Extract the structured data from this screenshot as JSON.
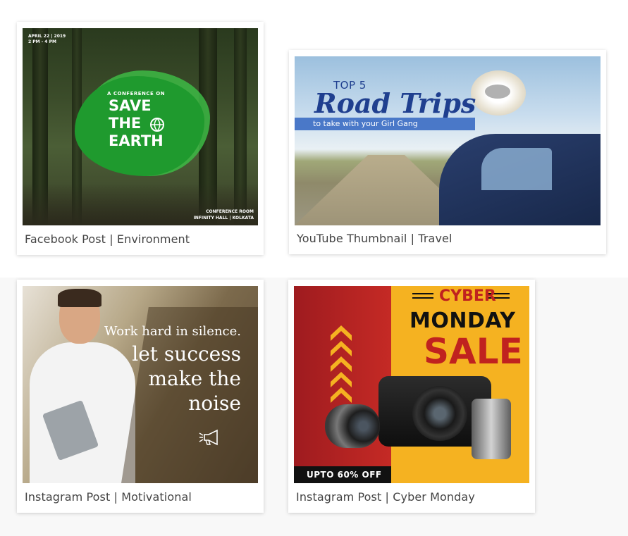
{
  "cards": [
    {
      "caption": "Facebook Post | Environment",
      "date_line": "APRIL 22 | 2019",
      "time_line": "2 PM - 4 PM",
      "kicker": "A CONFERENCE ON",
      "headline_1": "SAVE",
      "headline_2": "THE",
      "headline_3": "EARTH",
      "venue_1": "CONFERENCE ROOM",
      "venue_2": "INFINITY HALL | KOLKATA",
      "colors": {
        "blob": "#1f9a2e",
        "blob_light": "#3dbb45"
      }
    },
    {
      "caption": "YouTube Thumbnail | Travel",
      "small_title": "TOP 5",
      "big_title": "Road Trips",
      "banner": "to take with your Girl Gang",
      "colors": {
        "title": "#1f3f8f",
        "banner": "#4a78c8"
      }
    },
    {
      "caption": "Instagram Post | Motivational",
      "line_1": "Work hard in silence.",
      "line_2": "let success",
      "line_3": "make the",
      "line_4": "noise"
    },
    {
      "caption": "Instagram Post | Cyber Monday",
      "word_1": "CYBER",
      "word_2": "MONDAY",
      "word_3": "SALE",
      "offer": "UPTO 60% OFF",
      "colors": {
        "red": "#c0221f",
        "yellow": "#f5b221",
        "black": "#111111"
      }
    }
  ]
}
